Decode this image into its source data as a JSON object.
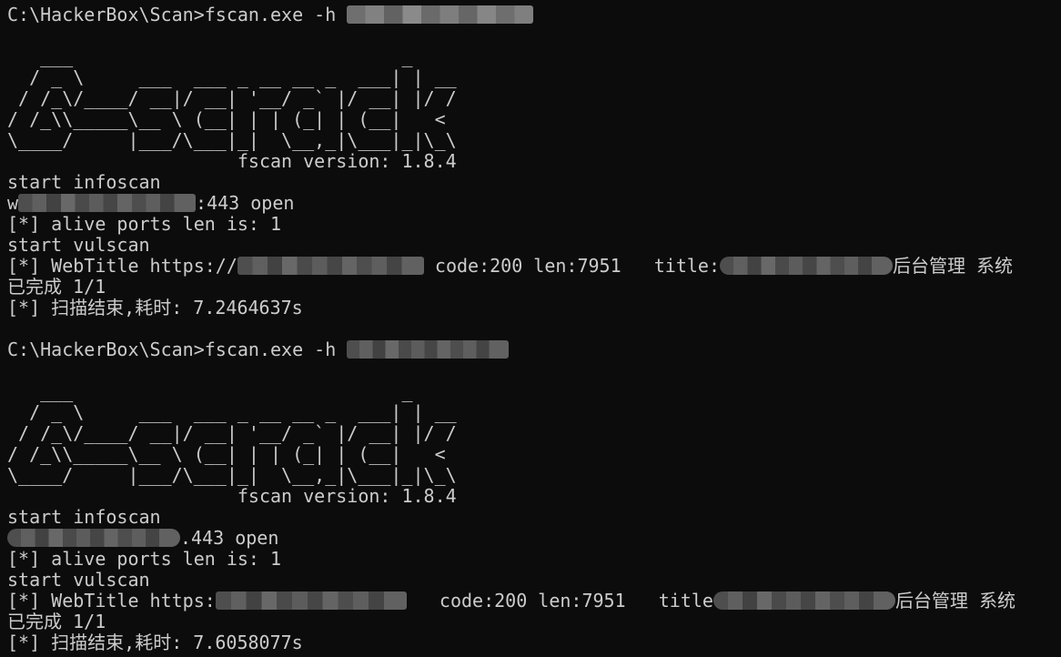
{
  "session1": {
    "prompt": "C:\\HackerBox\\Scan>fscan.exe -h ",
    "ascii_banner": "   ___                              _\n  / _ \\     ___  ___ _ __ __ _  ___| | __\n / /_\\/____/ __|/ __| '__/ _` |/ __| |/ /\n/ /_\\\\_____\\__ \\ (__| | | (_| | (__|   <\n\\____/     |___/\\___|_|  \\__,_|\\___|_|\\_\\",
    "version": "                     fscan version: 1.8.4",
    "start_infoscan": "start infoscan",
    "open_prefix": "w",
    "open_suffix": ":443 open",
    "alive_ports": "[*] alive ports len is: 1",
    "start_vulscan": "start vulscan",
    "webtitle_prefix": "[*] WebTitle https://",
    "webtitle_middle": " code:200 len:7951   title:",
    "webtitle_suffix": "后台管理 系统",
    "completed": "已完成 1/1",
    "scan_done": "[*] 扫描结束,耗时: 7.2464637s"
  },
  "session2": {
    "prompt": "C:\\HackerBox\\Scan>fscan.exe -h ",
    "ascii_banner": "   ___                              _\n  / _ \\     ___  ___ _ __ __ _  ___| | __\n / /_\\/____/ __|/ __| '__/ _` |/ __| |/ /\n/ /_\\\\_____\\__ \\ (__| | | (_| | (__|   <\n\\____/     |___/\\___|_|  \\__,_|\\___|_|\\_\\",
    "version": "                     fscan version: 1.8.4",
    "start_infoscan": "start infoscan",
    "open_suffix": ".443 open",
    "alive_ports": "[*] alive ports len is: 1",
    "start_vulscan": "start vulscan",
    "webtitle_prefix": "[*] WebTitle https:",
    "webtitle_middle": "   code:200 len:7951   title",
    "webtitle_suffix": "后台管理 系统",
    "completed": "已完成 1/1",
    "scan_done": "[*] 扫描结束,耗时: 7.6058077s"
  },
  "colors": {
    "background": "#0c0c0c",
    "foreground": "#cccccc"
  }
}
